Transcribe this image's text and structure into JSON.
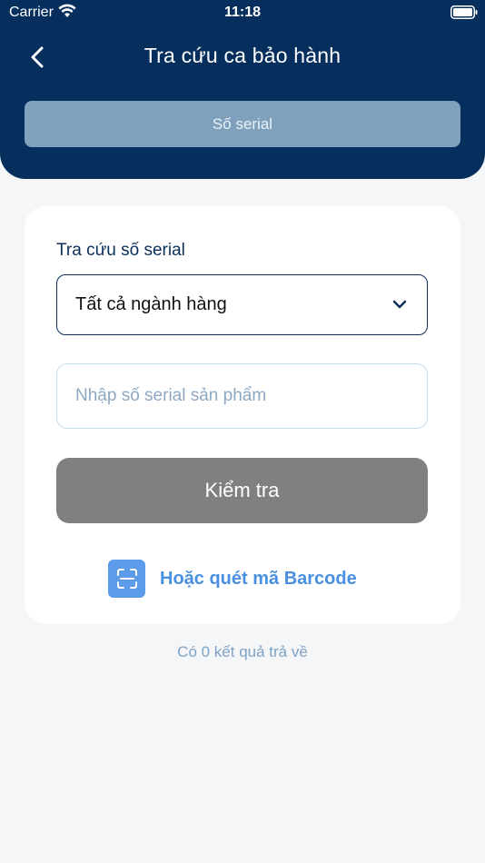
{
  "status_bar": {
    "carrier": "Carrier",
    "time": "11:18"
  },
  "header": {
    "title": "Tra cứu ca bảo hành",
    "tab_label": "Số serial"
  },
  "form": {
    "section_label": "Tra cứu số serial",
    "category_selected": "Tất cả ngành hàng",
    "serial_placeholder": "Nhập số serial sản phẩm",
    "check_button": "Kiểm tra",
    "scan_label": "Hoặc quét mã Barcode"
  },
  "results": {
    "count_text": "Có 0 kết quả trả về"
  },
  "colors": {
    "header_bg": "#062f5e",
    "tab_bg": "#7fa1bd",
    "button_disabled": "#808080",
    "accent": "#4a90e2",
    "page_bg": "#f5f6f8"
  }
}
